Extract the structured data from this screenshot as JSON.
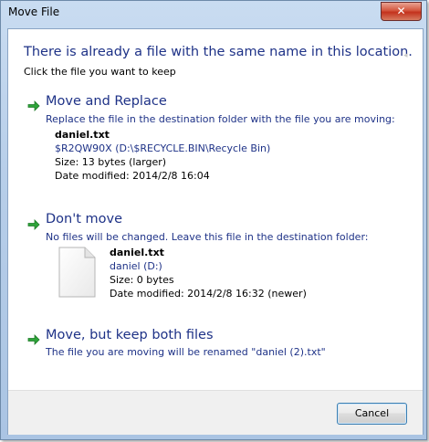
{
  "window": {
    "title": "Move File",
    "close_label": "✕"
  },
  "header": {
    "heading": "There is already a file with the same name in this location.",
    "subheading": "Click the file you want to keep"
  },
  "options": {
    "replace": {
      "title": "Move and Replace",
      "description": "Replace the file in the destination folder with the file you are moving:",
      "file_name": "daniel.txt",
      "location": "$R2QW90X (D:\\$RECYCLE.BIN\\Recycle Bin)",
      "size": "Size: 13 bytes (larger)",
      "date": "Date modified: 2014/2/8 16:04"
    },
    "dont_move": {
      "title": "Don't move",
      "description": "No files will be changed. Leave this file in the destination folder:",
      "file_name": "daniel.txt",
      "location": "daniel (D:)",
      "size": "Size: 0 bytes",
      "date": "Date modified: 2014/2/8 16:32 (newer)"
    },
    "keep_both": {
      "title": "Move, but keep both files",
      "description": "The file you are moving will be renamed \"daniel (2).txt\""
    }
  },
  "footer": {
    "cancel_label": "Cancel"
  },
  "colors": {
    "accent": "#1e3287",
    "arrow": "#2ea43a"
  }
}
